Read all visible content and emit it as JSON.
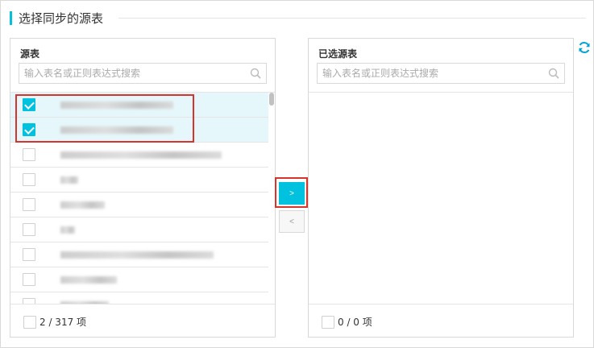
{
  "section": {
    "title": "选择同步的源表"
  },
  "source": {
    "header": "源表",
    "search_placeholder": "输入表名或正则表达式搜索",
    "footer_count": "2 / 317 项",
    "rows": [
      {
        "checked": true,
        "selected": true
      },
      {
        "checked": true,
        "selected": true
      },
      {
        "checked": false,
        "selected": false
      },
      {
        "checked": false,
        "selected": false
      },
      {
        "checked": false,
        "selected": false
      },
      {
        "checked": false,
        "selected": false
      },
      {
        "checked": false,
        "selected": false
      },
      {
        "checked": false,
        "selected": false
      },
      {
        "checked": false,
        "selected": false
      }
    ]
  },
  "target": {
    "header": "已选源表",
    "search_placeholder": "输入表名或正则表达式搜索",
    "footer_count": "0 / 0 项"
  },
  "transfer": {
    "to_right_label": ">",
    "to_left_label": "<"
  },
  "icons": {
    "search": "search-icon",
    "refresh": "refresh-icon"
  },
  "colors": {
    "accent": "#00c1de",
    "highlight": "#d9342b"
  }
}
